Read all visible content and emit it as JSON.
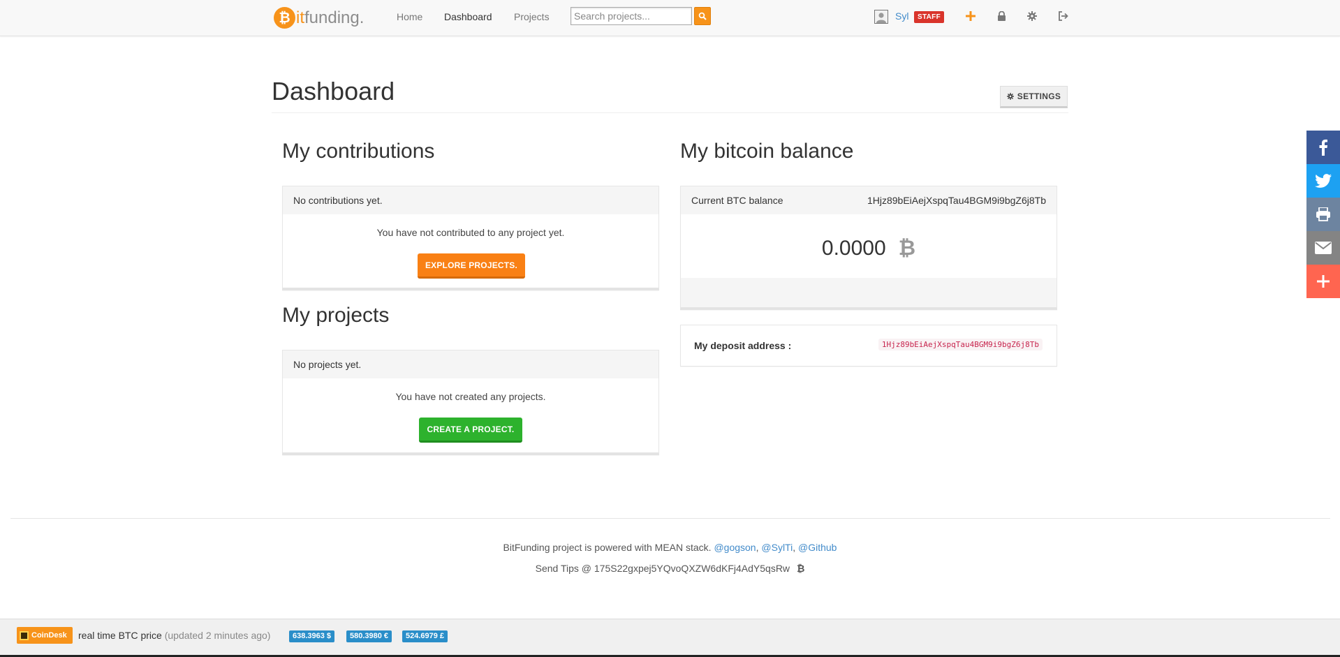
{
  "brand": {
    "coin_glyph": "₿",
    "part1": "it",
    "part2": "funding."
  },
  "nav": {
    "links": [
      {
        "label": "Home"
      },
      {
        "label": "Dashboard"
      },
      {
        "label": "Projects"
      }
    ],
    "search_placeholder": "Search projects...",
    "search_icon": "search-icon",
    "user": {
      "name": "Syl",
      "badge": "STAFF"
    },
    "icons": [
      "plus-icon",
      "lock-icon",
      "gear-icon",
      "sign-out-icon"
    ],
    "accent_color": "#f7931a"
  },
  "dashboard": {
    "title": "Dashboard",
    "settings_label": "SETTINGS",
    "contributions": {
      "title": "My contributions",
      "heading": "No contributions yet.",
      "message": "You have not contributed to any project yet.",
      "button": "EXPLORE PROJECTS."
    },
    "projects": {
      "title": "My projects",
      "heading": "No projects yet.",
      "message": "You have not created any projects.",
      "button": "CREATE A PROJECT."
    },
    "balance": {
      "title": "My bitcoin balance",
      "label": "Current BTC balance",
      "address": "1Hjz89bEiAejXspqTau4BGM9i9bgZ6j8Tb",
      "amount": "0.0000",
      "currency_symbol": "₿"
    },
    "deposit": {
      "label": "My deposit address :",
      "address": "1Hjz89bEiAejXspqTau4BGM9i9bgZ6j8Tb"
    }
  },
  "share": [
    {
      "icon": "facebook-icon",
      "color": "#3b5998"
    },
    {
      "icon": "twitter-icon",
      "color": "#1da1f2"
    },
    {
      "icon": "print-icon",
      "color": "#6d84a0"
    },
    {
      "icon": "email-icon",
      "color": "#848484"
    },
    {
      "icon": "more-plus-icon",
      "color": "#ff6550"
    }
  ],
  "footer": {
    "powered_text": "BitFunding project is powered with MEAN stack.",
    "link_gogson": "@gogson",
    "sep1": ",",
    "link_sylti": "@SylTi",
    "sep2": ",",
    "link_github": "@Github",
    "tips_text": "Send Tips @ 175S22gxpej5YQvoQXZW6dKFj4AdY5qsRw",
    "tips_symbol": "₿"
  },
  "ticker": {
    "brand": "CoinDesk",
    "label": "real time BTC price",
    "updated": "(updated 2 minutes ago)",
    "prices": [
      "638.3963 $",
      "580.3980 €",
      "524.6979 £"
    ]
  }
}
